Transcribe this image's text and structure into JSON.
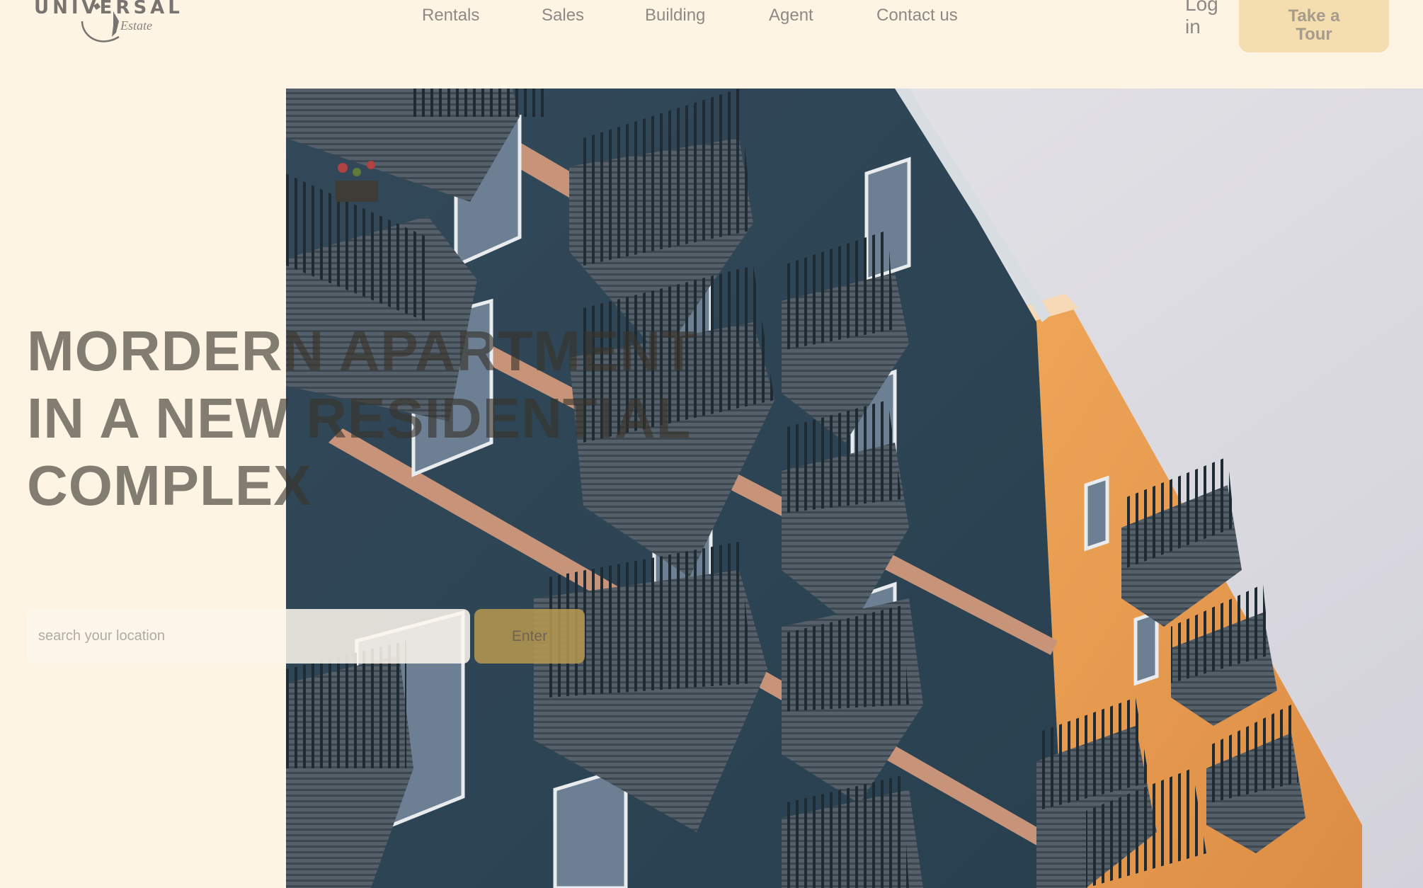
{
  "brand": {
    "name": "UNIVERSAL",
    "tagline": "Estate"
  },
  "nav": {
    "items": [
      {
        "label": "Rentals"
      },
      {
        "label": "Sales"
      },
      {
        "label": "Building"
      },
      {
        "label": "Agent"
      },
      {
        "label": "Contact us"
      }
    ]
  },
  "header_actions": {
    "login_label": "Log in",
    "tour_line1": "Take a",
    "tour_line2": "Tour"
  },
  "hero": {
    "title_lines": [
      "MORDERN APARTMENT",
      "IN A NEW RESIDENTIAL",
      "COMPLEX"
    ],
    "image_semantic": "apartment-building-balconies-photo"
  },
  "search": {
    "placeholder": "search your location",
    "value": "",
    "button_label": "Enter"
  },
  "colors": {
    "background": "#fdf4e4",
    "accent": "#f4ddae",
    "button": "#b4964f",
    "text_muted": "#8e8984",
    "building_blue": "#2f4656",
    "building_orange": "#e59a4f",
    "sky": "#dcdbe0"
  }
}
